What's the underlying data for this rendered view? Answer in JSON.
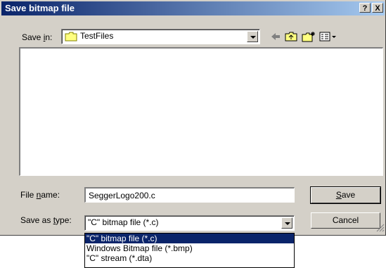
{
  "window": {
    "title": "Save bitmap file"
  },
  "title_buttons": {
    "help": "?",
    "close": "X"
  },
  "save_in": {
    "label_prefix": "Save ",
    "label_accel": "i",
    "label_suffix": "n:",
    "value": "TestFiles"
  },
  "toolbar": {
    "back_icon": "back-arrow-icon",
    "up_icon": "up-folder-icon",
    "new_icon": "new-folder-icon",
    "view_icon": "view-menu-icon"
  },
  "file_name": {
    "label_prefix": "File ",
    "label_accel": "n",
    "label_suffix": "ame:",
    "value": "SeggerLogo200.c"
  },
  "save_type": {
    "label_prefix": "Save as ",
    "label_accel": "t",
    "label_suffix": "ype:",
    "value": "\"C\" bitmap file (*.c)",
    "options": [
      "\"C\" bitmap file (*.c)",
      "Windows Bitmap file (*.bmp)",
      "\"C\" stream (*.dta)"
    ]
  },
  "buttons": {
    "save_accel": "S",
    "save_rest": "ave",
    "cancel": "Cancel"
  }
}
